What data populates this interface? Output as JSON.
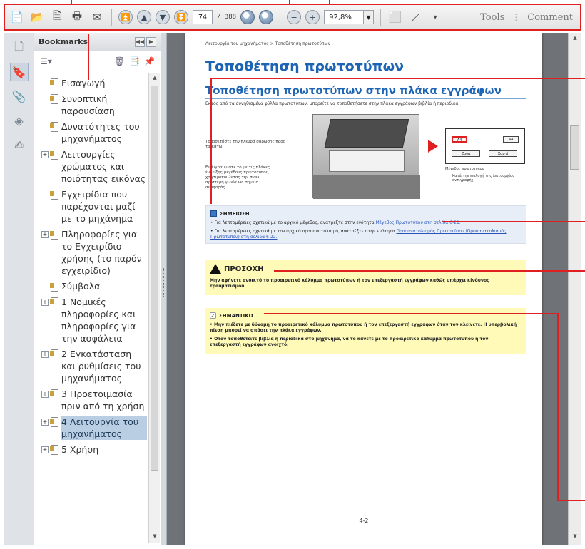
{
  "toolbar": {
    "page_current": "74",
    "page_total": "/ 388",
    "zoom": "92,8%",
    "tools_label": "Tools",
    "comment_label": "Comment"
  },
  "bookmarks": {
    "title": "Bookmarks",
    "items": [
      {
        "label": "Εισαγωγή",
        "expandable": false
      },
      {
        "label": "Συνοπτική παρουσίαση",
        "expandable": false
      },
      {
        "label": "Δυνατότητες του μηχανήματος",
        "expandable": false
      },
      {
        "label": "Λειτουργίες χρώματος και ποιότητας εικόνας",
        "expandable": true
      },
      {
        "label": "Εγχειρίδια που παρέχονται μαζί με το μηχάνημα",
        "expandable": false
      },
      {
        "label": "Πληροφορίες για το Εγχειρίδιο χρήσης (το παρόν εγχειρίδιο)",
        "expandable": true
      },
      {
        "label": "Σύμβολα",
        "expandable": false
      },
      {
        "label": "1 Νομικές πληροφορίες και πληροφορίες για την ασφάλεια",
        "expandable": true
      },
      {
        "label": "2 Εγκατάσταση και ρυθμίσεις του μηχανήματος",
        "expandable": true
      },
      {
        "label": "3 Προετοιμασία πριν από τη χρήση",
        "expandable": true
      },
      {
        "label": "4 Λειτουργία του μηχανήματος",
        "expandable": true,
        "selected": true
      },
      {
        "label": "5 Χρήση",
        "expandable": true
      }
    ]
  },
  "document": {
    "breadcrumb": "Λειτουργία του μηχανήματος > Τοποθέτηση πρωτοτύπων",
    "heading": "Τοποθέτηση πρωτοτύπων",
    "subheading": "Τοποθέτηση πρωτοτύπων στην πλάκα εγγράφων",
    "intro": "Εκτός από τα συνηθισμένα φύλλα πρωτοτύπων, μπορείτε να τοποθετήσετε στην πλάκα εγγράφων βιβλία ή περιοδικά.",
    "illus_text_1": "Τοποθετήστε την πλευρά σάρωσης προς τα κάτω.",
    "illus_text_2": "Ευθυγραμμίστε το με τις πλάκες ένδειξης μεγέθους πρωτοτύπου, χρησιμοποιώντας την πίσω αριστερή γωνία ως σημείο αναφοράς.",
    "panel_btn_1": "A4",
    "panel_btn_2": "A4",
    "panel_zoom": "Ζουμ",
    "panel_paper": "Χαρτί",
    "panel_caption": "Μέγεθος πρωτοτύπου",
    "panel_note": "Κατά την επιλογή της λειτουργίας αντιγραφής",
    "note_title": "ΣΗΜΕΙΩΣΗ",
    "note_line_1": "Για λεπτομέρειες σχετικά με το αρχικό μέγεθος, ανατρέξτε στην ενότητα",
    "note_link_1": "Μέγεθος Πρωτοτύπου στη σελίδα 6-21.",
    "note_line_2": "Για λεπτομέρειες σχετικά με τον αρχικό προσανατολισμό, ανατρέξτε στην ενότητα",
    "note_link_2": "Προσανατολισμός Πρωτοτύπου (Προσανατολισμός Πρωτοτύπου) στη σελίδα 6-22.",
    "warn_title": "ΠΡΟΣΟΧΗ",
    "warn_text": "Μην αφήνετε ανοικτό το προαιρετικό κάλυμμα πρωτοτύπων ή τον επεξεργαστή εγγράφων καθώς υπάρχει κίνδυνος τραυματισμού.",
    "imp_title": "ΣΗΜΑΝΤΙΚΟ",
    "imp_line_1": "Μην πιέζετε με δύναμη το προαιρετικό κάλυμμα πρωτοτύπου ή τον επεξεργαστή εγγράφων όταν τον κλείνετε. Η υπερβολική πίεση μπορεί να σπάσει την πλάκα εγγράφων.",
    "imp_line_2": "Όταν τοποθετείτε βιβλία ή περιοδικά στο μηχάνημα, να το κάνετε με το προαιρετικό κάλυμμα πρωτοτύπου ή τον επεξεργαστή εγγράφων ανοιχτό.",
    "page_number": "4-2"
  },
  "colors": {
    "callout": "#e02020",
    "heading_blue": "#1c64b4",
    "note_bg": "#e8eef7",
    "warn_bg": "#fffab8"
  }
}
